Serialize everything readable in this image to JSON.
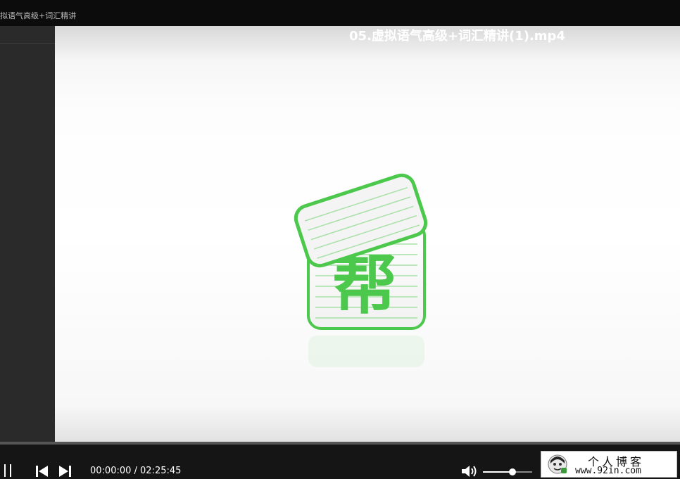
{
  "window": {
    "tab_title": "拟语气高级+词汇精讲"
  },
  "video": {
    "title": "05.虚拟语气高级+词汇精讲(1).mp4",
    "logo_character": "帮",
    "brand_color": "#4cc94c"
  },
  "controls": {
    "time_display": "00:00:00 / 02:25:45",
    "progress_fraction": 0.0,
    "volume_fraction": 0.6,
    "icons": [
      "pause-icon",
      "previous-icon",
      "next-icon",
      "volume-icon"
    ]
  },
  "watermark": {
    "title": "个人博客",
    "url": "www.92in.com"
  }
}
